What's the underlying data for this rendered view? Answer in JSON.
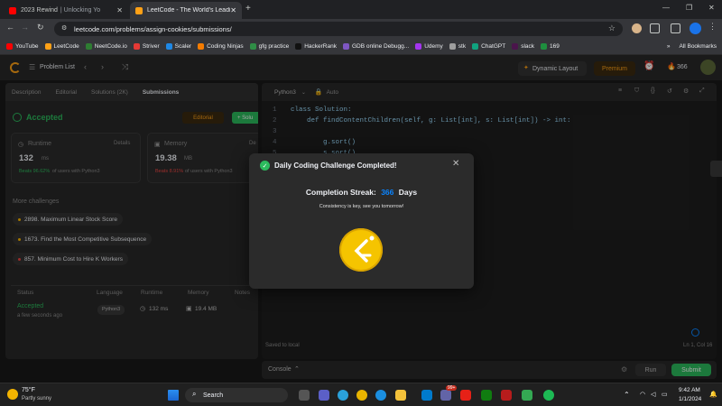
{
  "browser": {
    "tabs": [
      {
        "title": "2023 Rewind",
        "badge": "| Unlocking Yo",
        "icon_color": "#ff0000",
        "active": false
      },
      {
        "title": "LeetCode - The World's Leading",
        "icon_color": "#ffa116",
        "active": true
      }
    ],
    "new_tab": "+",
    "url": "leetcode.com/problems/assign-cookies/submissions/",
    "bookmarks": [
      {
        "label": "YouTube",
        "color": "#ff0000"
      },
      {
        "label": "LeetCode",
        "color": "#ffa116"
      },
      {
        "label": "NeetCode.io",
        "color": "#2e7d32"
      },
      {
        "label": "Striver",
        "color": "#e53935"
      },
      {
        "label": "Scaler",
        "color": "#1e88e5"
      },
      {
        "label": "Coding Ninjas",
        "color": "#f57c00"
      },
      {
        "label": "gfg practice",
        "color": "#2f8d46"
      },
      {
        "label": "HackerRank",
        "color": "#111111"
      },
      {
        "label": "GDB online Debugg...",
        "color": "#7e57c2"
      },
      {
        "label": "Udemy",
        "color": "#a435f0"
      },
      {
        "label": "stk",
        "color": "#9e9e9e"
      },
      {
        "label": "ChatGPT",
        "color": "#10a37f"
      },
      {
        "label": "slack",
        "color": "#4a154b"
      },
      {
        "label": "169",
        "color": "#1e8e3e"
      }
    ],
    "overflow": "»",
    "all_bookmarks": "All Bookmarks"
  },
  "nav": {
    "problem_list": "Problem List",
    "dynamic_layout": "Dynamic Layout",
    "premium": "Premium",
    "streak_count": "366"
  },
  "left": {
    "tabs": [
      "Description",
      "Editorial",
      "Solutions (2K)",
      "Submissions"
    ],
    "status": "Accepted",
    "editorial_btn": "Editorial",
    "solution_btn": "+ Solu",
    "runtime": {
      "label": "Runtime",
      "value": "132",
      "unit": "ms",
      "details": "Details",
      "beats_pct": "Beats 96.62%",
      "beats_rest": "of users with Python3"
    },
    "memory": {
      "label": "Memory",
      "value": "19.38",
      "unit": "MB",
      "details": "De",
      "beats_pct": "Beats 8.91%",
      "beats_rest": "of users with Python3"
    },
    "more_challenges": "More challenges",
    "challenges": [
      {
        "title": "2898. Maximum Linear Stock Score",
        "color": "#ffb800"
      },
      {
        "title": "1673. Find the Most Competitive Subsequence",
        "color": "#ffb800"
      },
      {
        "title": "857. Minimum Cost to Hire K Workers",
        "color": "#ef4743"
      }
    ],
    "table_headers": [
      "Status",
      "Language",
      "Runtime",
      "Memory",
      "Notes"
    ],
    "row": {
      "status": "Accepted",
      "time": "a few seconds ago",
      "language": "Python3",
      "runtime": "132 ms",
      "memory": "19.4 MB"
    }
  },
  "editor": {
    "language": "Python3",
    "mode": "Auto",
    "lines": [
      {
        "n": "1",
        "text": "class Solution:"
      },
      {
        "n": "2",
        "text": "    def findContentChildren(self, g: List[int], s: List[int]) -> int:"
      },
      {
        "n": "3",
        "text": ""
      },
      {
        "n": "4",
        "text": "        g.sort()"
      },
      {
        "n": "5",
        "text": "        s.sort()"
      }
    ],
    "saved": "Saved to local",
    "position": "Ln 1, Col 16",
    "console": "Console",
    "run": "Run",
    "submit": "Submit"
  },
  "modal": {
    "title": "Daily Coding Challenge Completed!",
    "streak_label": "Completion Streak:",
    "streak_value": "366",
    "streak_unit": "Days",
    "subtitle": "Consistency is key, see you tomorrow!"
  },
  "taskbar": {
    "temp": "75°F",
    "weather": "Partly sunny",
    "search": "Search",
    "time": "9:42 AM",
    "date": "1/1/2024",
    "badge": "99+"
  },
  "colors": {
    "accent": "#ffa116",
    "green": "#2cbb5d",
    "blue": "#0a84ff",
    "red": "#ef4743"
  }
}
